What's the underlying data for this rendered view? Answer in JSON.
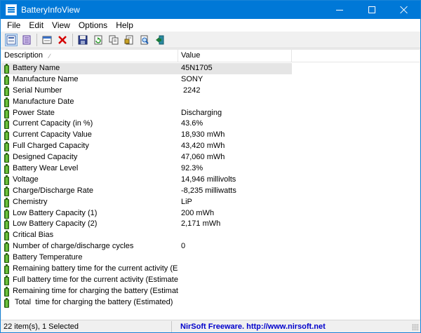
{
  "window": {
    "title": "BatteryInfoView"
  },
  "menu": [
    "File",
    "Edit",
    "View",
    "Options",
    "Help"
  ],
  "toolbar": {
    "buttons": [
      {
        "icon": "battery-info-mode-icon",
        "pressed": true
      },
      {
        "icon": "log-mode-icon"
      },
      {
        "icon": "properties-icon"
      },
      {
        "icon": "delete-icon"
      },
      {
        "icon": "save-icon"
      },
      {
        "icon": "refresh-icon"
      },
      {
        "icon": "copy-icon"
      },
      {
        "icon": "html-report-icon"
      },
      {
        "icon": "find-icon"
      },
      {
        "icon": "exit-icon"
      }
    ]
  },
  "list": {
    "columns": {
      "description": "Description",
      "value": "Value"
    },
    "rows": [
      {
        "description": "Battery Name",
        "value": "45N1705",
        "selected": true
      },
      {
        "description": "Manufacture Name",
        "value": "SONY"
      },
      {
        "description": "Serial Number",
        "value": " 2242"
      },
      {
        "description": "Manufacture Date",
        "value": ""
      },
      {
        "description": "Power State",
        "value": "Discharging"
      },
      {
        "description": "Current Capacity (in %)",
        "value": "43.6%"
      },
      {
        "description": "Current Capacity Value",
        "value": "18,930 mWh"
      },
      {
        "description": "Full Charged Capacity",
        "value": "43,420 mWh"
      },
      {
        "description": "Designed Capacity",
        "value": "47,060 mWh"
      },
      {
        "description": "Battery Wear Level",
        "value": "92.3%"
      },
      {
        "description": "Voltage",
        "value": "14,946 millivolts"
      },
      {
        "description": "Charge/Discharge Rate",
        "value": "-8,235 milliwatts"
      },
      {
        "description": "Chemistry",
        "value": "LiP"
      },
      {
        "description": "Low Battery Capacity (1)",
        "value": "200 mWh"
      },
      {
        "description": "Low Battery Capacity (2)",
        "value": "2,171 mWh"
      },
      {
        "description": "Critical Bias",
        "value": ""
      },
      {
        "description": "Number of charge/discharge cycles",
        "value": "0"
      },
      {
        "description": "Battery Temperature",
        "value": ""
      },
      {
        "description": "Remaining battery time for the current activity (Est...",
        "value": ""
      },
      {
        "description": "Full battery time for the current activity (Estimated)",
        "value": ""
      },
      {
        "description": "Remaining time for charging the battery (Estimated)",
        "value": ""
      },
      {
        "description": " Total  time for charging the battery (Estimated)",
        "value": ""
      }
    ]
  },
  "status": {
    "items": "22 item(s), 1 Selected",
    "credit": "NirSoft Freeware.  http://www.nirsoft.net"
  }
}
